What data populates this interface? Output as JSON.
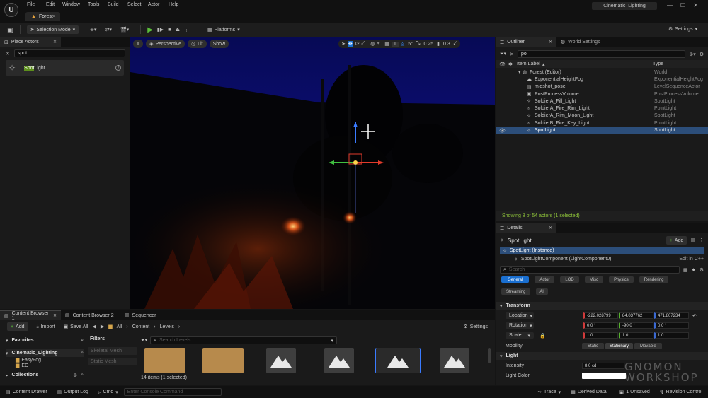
{
  "menubar": {
    "items": [
      "File",
      "Edit",
      "Window",
      "Tools",
      "Build",
      "Select",
      "Actor",
      "Help"
    ],
    "project_name": "Cinematic_Lighting"
  },
  "level_tab": {
    "label": "Forest•"
  },
  "toolbar": {
    "selection_mode": "Selection Mode",
    "platforms": "Platforms",
    "settings": "Settings"
  },
  "place_actors": {
    "tab_label": "Place Actors",
    "search_value": "spot",
    "result_label": "Light",
    "result_highlight": "Spot"
  },
  "viewport": {
    "perspective": "Perspective",
    "lit": "Lit",
    "show": "Show",
    "grid_value": "1",
    "angle_value": "5°",
    "scale_value": "0.25",
    "camera_value": "0.3"
  },
  "outliner": {
    "tab_label": "Outliner",
    "world_settings_tab": "World Settings",
    "search_value": "po",
    "col_label": "Item Label",
    "col_type": "Type",
    "rows": [
      {
        "label": "Forest (Editor)",
        "type": "World"
      },
      {
        "label": "ExponentialHeightFog",
        "type": "ExponentialHeightFog"
      },
      {
        "label": "midshot_pose",
        "type": "LevelSequenceActor"
      },
      {
        "label": "PostProcessVolume",
        "type": "PostProcessVolume"
      },
      {
        "label": "SoldierA_Fill_Light",
        "type": "SpotLight"
      },
      {
        "label": "SoldierA_Fire_Rim_Light",
        "type": "PointLight"
      },
      {
        "label": "SoldierA_Rim_Moon_Light",
        "type": "SpotLight"
      },
      {
        "label": "SoldierB_Fire_Key_Light",
        "type": "PointLight"
      },
      {
        "label": "SpotLight",
        "type": "SpotLight"
      }
    ],
    "status": "Showing 8 of 54 actors (1 selected)"
  },
  "details": {
    "tab_label": "Details",
    "actor_name": "SpotLight",
    "add_label": "Add",
    "instance_label": "SpotLight (Instance)",
    "component_label": "SpotLightComponent (LightComponent0)",
    "edit_cpp": "Edit in C++",
    "search_placeholder": "Search",
    "categories": [
      "General",
      "Actor",
      "LOD",
      "Misc",
      "Physics",
      "Rendering",
      "Streaming",
      "All"
    ],
    "transform_header": "Transform",
    "location_label": "Location",
    "rotation_label": "Rotation",
    "scale_label": "Scale",
    "location": [
      "-222.028799",
      "84.037762",
      "471.807234"
    ],
    "rotation": [
      "0.0 °",
      "-90.0 °",
      "0.0 °"
    ],
    "scale": [
      "1.0",
      "1.0",
      "1.0"
    ],
    "mobility_label": "Mobility",
    "mobility_options": [
      "Static",
      "Stationary",
      "Movable"
    ],
    "light_header": "Light",
    "intensity_label": "Intensity",
    "intensity_value": "8.0 cd",
    "light_color_label": "Light Color"
  },
  "content_browser": {
    "tabs": [
      "Content Browser 1",
      "Content Browser 2",
      "Sequencer"
    ],
    "add_label": "Add",
    "import_label": "Import",
    "save_all_label": "Save All",
    "path": [
      "All",
      "Content",
      "Levels"
    ],
    "settings_label": "Settings",
    "favorites_label": "Favorites",
    "project_folder": "Cinematic_Lighting",
    "tree": [
      "EasyFog",
      "EO"
    ],
    "collections_label": "Collections",
    "filters_label": "Filters",
    "filters": [
      "Skeletal Mesh",
      "Static Mesh"
    ],
    "search_placeholder": "Search Levels",
    "status": "14 items (1 selected)"
  },
  "statusbar": {
    "content_drawer": "Content Drawer",
    "output_log": "Output Log",
    "cmd": "Cmd",
    "console_placeholder": "Enter Console Command",
    "trace": "Trace",
    "derived_data": "Derived Data",
    "unsaved": "1 Unsaved",
    "revision_control": "Revision Control"
  },
  "watermark": {
    "line1": "GNOMON",
    "line2": "WORKSHOP"
  }
}
